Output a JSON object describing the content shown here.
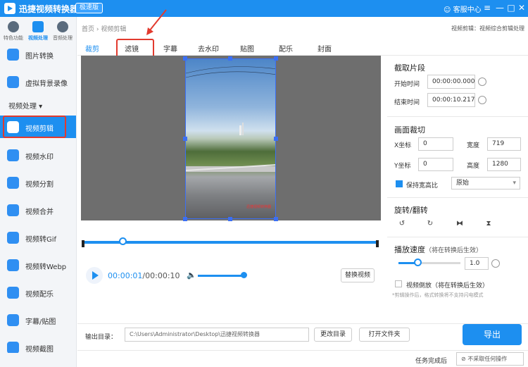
{
  "app": {
    "title": "迅捷视频转换器",
    "badge": "极速版",
    "service": "客服中心",
    "min": "—",
    "max": "□",
    "close": "✕"
  },
  "categories": [
    {
      "label": "特色功能",
      "icon": "star-icon"
    },
    {
      "label": "视频处理",
      "icon": "video-icon"
    },
    {
      "label": "音频处理",
      "icon": "audio-icon"
    }
  ],
  "nav_top": [
    {
      "label": "图片转换"
    },
    {
      "label": "虚拟背景录像"
    }
  ],
  "nav_section": "视频处理 ▾",
  "nav": [
    {
      "label": "视频剪辑"
    },
    {
      "label": "视频水印"
    },
    {
      "label": "视频分割"
    },
    {
      "label": "视频合并"
    },
    {
      "label": "视频转Gif"
    },
    {
      "label": "视频转Webp"
    },
    {
      "label": "视频配乐"
    },
    {
      "label": "字幕/贴图"
    },
    {
      "label": "视频截图"
    }
  ],
  "breadcrumb": "首页 › 视频剪辑",
  "right_caption": "视频剪辑：视频综合剪辑处理",
  "tabs": [
    "裁剪",
    "滤镜",
    "字幕",
    "去水印",
    "贴图",
    "配乐",
    "封面"
  ],
  "video": {
    "watermark": "迅捷视频转换器"
  },
  "player": {
    "current": "00:00:01",
    "total": "/00:00:10",
    "replace": "替换视频",
    "playhead_fraction": 0.1,
    "volume_fraction": 1.0
  },
  "clip": {
    "title": "截取片段",
    "start_label": "开始时间",
    "start": "00:00:00.000",
    "end_label": "结束时间",
    "end": "00:00:10.217"
  },
  "crop": {
    "title": "画面裁切",
    "x_label": "X坐标",
    "x": "0",
    "w_label": "宽度",
    "w": "719",
    "y_label": "Y坐标",
    "y": "0",
    "h_label": "高度",
    "h": "1280",
    "keep_label": "保持宽高比",
    "ratio": "原始"
  },
  "rotate": {
    "title": "旋转/翻转",
    "rot_left": "90°",
    "rot_right": "90°",
    "flip_h": "⧓",
    "flip_v": "⧗"
  },
  "speed": {
    "title": "播放速度",
    "note": "（将在转换后生效）",
    "value": "1.0",
    "slider_fraction": 0.3
  },
  "reverse": {
    "label": "视频倒放（将在转换后生效）",
    "note": "*剪辑操作后，格式转换将不支持闪电模式"
  },
  "output": {
    "label": "输出目录：",
    "path": "C:\\Users\\Administrator\\Desktop\\迅捷视频转换器",
    "change": "更改目录",
    "open": "打开文件夹",
    "export": "导出"
  },
  "status": {
    "done_label": "任务完成后",
    "option": "⊘ 不采取任何操作"
  },
  "colors": {
    "accent": "#1d8ff0",
    "highlight": "#e23a2e"
  }
}
